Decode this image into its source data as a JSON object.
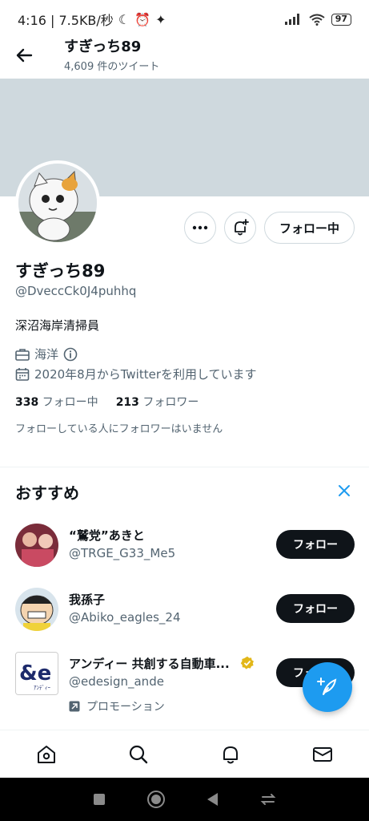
{
  "status_bar": {
    "time_speed": "4:16 | 7.5KB/秒",
    "battery": "97"
  },
  "header": {
    "title": "すぎっち89",
    "tweet_count": "4,609 件のツイート"
  },
  "profile": {
    "name": "すぎっち89",
    "handle": "@DveccCk0J4puhhq",
    "bio": "深沼海岸清掃員",
    "location": "海洋",
    "joined": "2020年8月からTwitterを利用しています",
    "following_count": "338",
    "following_label": "フォロー中",
    "followers_count": "213",
    "followers_label": "フォロワー",
    "no_known_followers": "フォローしている人にフォロワーはいません",
    "following_button": "フォロー中"
  },
  "recommendations": {
    "title": "おすすめ",
    "follow_label": "フォロー",
    "items": [
      {
        "name": "“鷲党”あきと",
        "handle": "@TRGE_G33_Me5"
      },
      {
        "name": "我孫子",
        "handle": "@Abiko_eagles_24"
      },
      {
        "name": "アンディー 共創する自動車...",
        "handle": "@edesign_ande",
        "promo": "プロモーション",
        "verified_color": "#e2b719"
      }
    ]
  },
  "colors": {
    "accent": "#1d9bf0",
    "banner": "#cfd9de"
  }
}
